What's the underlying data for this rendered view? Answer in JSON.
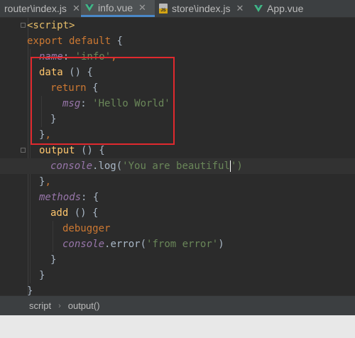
{
  "tabs": [
    {
      "label": "router\\index.js",
      "icon": "none",
      "active": false
    },
    {
      "label": "info.vue",
      "icon": "vue-icon",
      "active": true
    },
    {
      "label": "store\\index.js",
      "icon": "js-icon",
      "active": false
    },
    {
      "label": "App.vue",
      "icon": "vue-icon",
      "active": false
    }
  ],
  "close_glyph": "✕",
  "code": {
    "l1": "<script>",
    "l2a": "export default",
    "l2b": " {",
    "l3a": "name",
    "l3b": ": ",
    "l3c": "'info'",
    "l3d": ",",
    "l4a": "data",
    "l4b": " () {",
    "l5a": "return",
    "l5b": " {",
    "l6a": "msg",
    "l6b": ": ",
    "l6c": "'Hello World'",
    "l7": "}",
    "l8a": "}",
    "l8b": ",",
    "l9a": "output",
    "l9b": " () {",
    "l10a": "console",
    "l10b": ".log(",
    "l10c": "'You are beautiful",
    "l10d": "')",
    "l11a": "}",
    "l11b": ",",
    "l12a": "methods",
    "l12b": ": {",
    "l13a": "add",
    "l13b": " () {",
    "l14": "debugger",
    "l15a": "console",
    "l15b": ".error(",
    "l15c": "'from error'",
    "l15d": ")",
    "l16": "}",
    "l17": "}",
    "l18": "}"
  },
  "breadcrumb": {
    "first": "script",
    "sep": "›",
    "second": "output()"
  },
  "colors": {
    "highlight": "#e0292e",
    "keyword": "#cc7832",
    "string": "#6a8759",
    "function": "#ffc66d"
  }
}
